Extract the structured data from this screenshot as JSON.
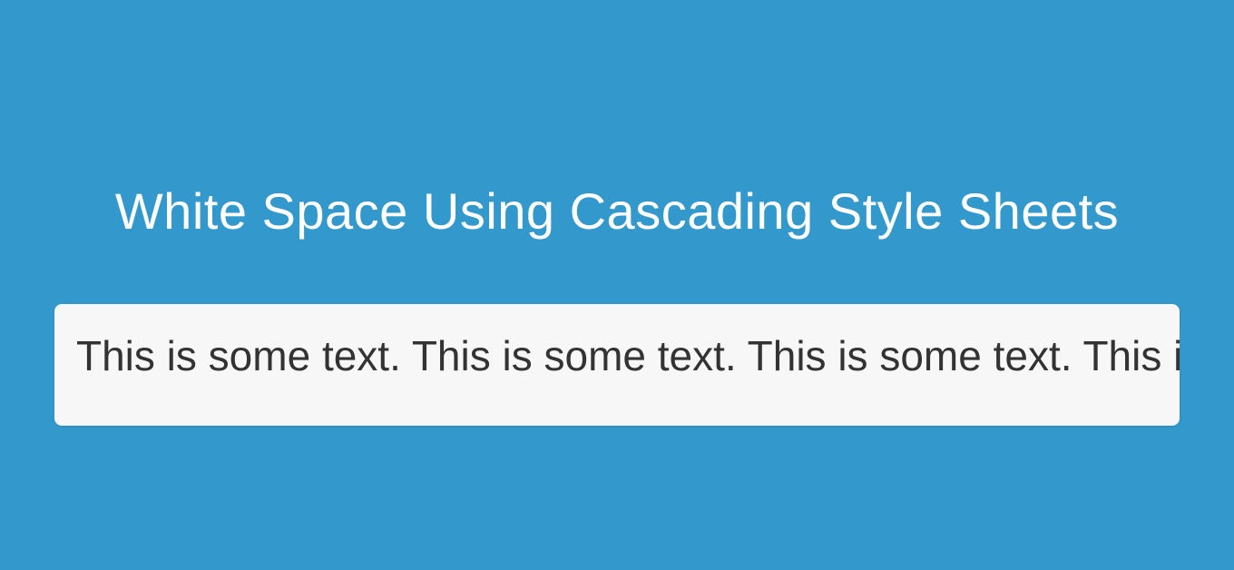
{
  "heading": "White Space Using Cascading Style Sheets",
  "body_text": "This is some text. This is some text. This is some text. This is some text."
}
